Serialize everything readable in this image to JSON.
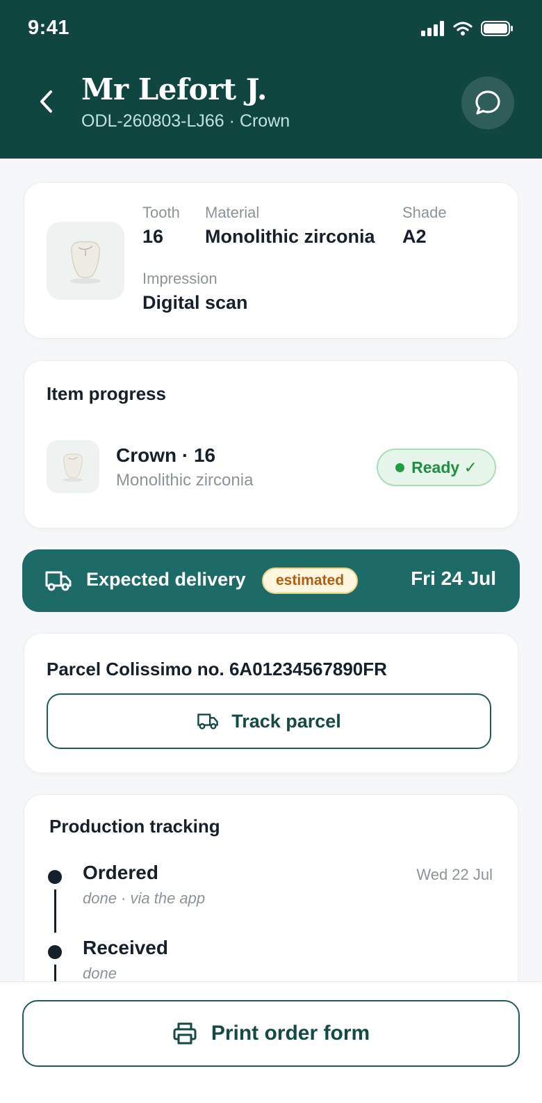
{
  "status_bar": {
    "time": "9:41"
  },
  "header": {
    "title": "Mr Lefort J.",
    "subtitle": "ODL-260803-LJ66 · Crown",
    "back_icon": "chevron-left-icon",
    "chat_icon": "chat-bubble-icon"
  },
  "spec": {
    "tooth_label": "Tooth",
    "tooth_value": "16",
    "material_label": "Material",
    "material_value": "Monolithic zirconia",
    "shade_label": "Shade",
    "shade_value": "A2",
    "impression_label": "Impression",
    "impression_value": "Digital scan"
  },
  "progress": {
    "title": "Item progress",
    "item_name": "Crown · 16",
    "item_sub": "Monolithic zirconia",
    "status": "Ready ✓"
  },
  "delivery": {
    "label": "Expected delivery",
    "badge": "estimated",
    "date": "Fri 24 Jul",
    "icon": "truck-icon"
  },
  "parcel": {
    "number_text": "Parcel Colissimo no. 6A01234567890FR",
    "track_label": "Track parcel"
  },
  "production": {
    "title": "Production tracking",
    "steps": [
      {
        "name": "Ordered",
        "sub": "done · via the app",
        "date": "Wed 22 Jul"
      },
      {
        "name": "Received",
        "sub": "done",
        "date": ""
      }
    ]
  },
  "footer": {
    "print_label": "Print order form",
    "print_icon": "printer-icon"
  },
  "colors": {
    "header_bg": "#0f4640",
    "accent": "#1c6b66",
    "ready_green": "#1f8f42",
    "estimated_orange": "#b75b0c"
  }
}
